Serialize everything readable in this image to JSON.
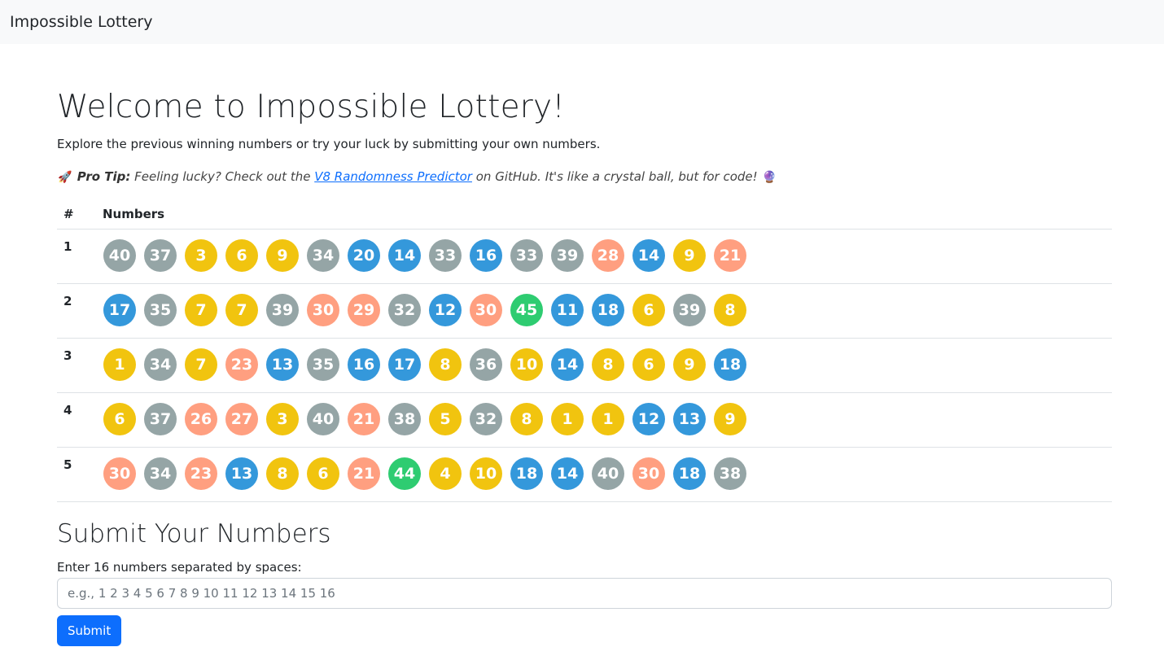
{
  "navbar": {
    "brand": "Impossible Lottery"
  },
  "main": {
    "title": "Welcome to Impossible Lottery!",
    "intro": "Explore the previous winning numbers or try your luck by submitting your own numbers.",
    "tip": {
      "emoji": "🚀",
      "label": "Pro Tip:",
      "text_before": "Feeling lucky? Check out the",
      "link": "V8 Randomness Predictor",
      "text_after": "on GitHub. It's like a crystal ball, but for code!",
      "emoji_end": "🔮"
    }
  },
  "table": {
    "headers": {
      "index": "#",
      "numbers": "Numbers"
    },
    "rows": [
      {
        "index": "1",
        "numbers": [
          40,
          37,
          3,
          6,
          9,
          34,
          20,
          14,
          33,
          16,
          33,
          39,
          28,
          14,
          9,
          21
        ]
      },
      {
        "index": "2",
        "numbers": [
          17,
          35,
          7,
          7,
          39,
          30,
          29,
          32,
          12,
          30,
          45,
          11,
          18,
          6,
          39,
          8
        ]
      },
      {
        "index": "3",
        "numbers": [
          1,
          34,
          7,
          23,
          13,
          35,
          16,
          17,
          8,
          36,
          10,
          14,
          8,
          6,
          9,
          18
        ]
      },
      {
        "index": "4",
        "numbers": [
          6,
          37,
          26,
          27,
          3,
          40,
          21,
          38,
          5,
          32,
          8,
          1,
          1,
          12,
          13,
          9
        ]
      },
      {
        "index": "5",
        "numbers": [
          30,
          34,
          23,
          13,
          8,
          6,
          21,
          44,
          4,
          10,
          18,
          14,
          40,
          30,
          18,
          38
        ]
      }
    ],
    "ball_colors": {
      "1-10": "#f1c40f",
      "11-20": "#3498db",
      "21-30": "#ff9f80",
      "31-40": "#95a5a6",
      "41-45": "#2ecc71"
    }
  },
  "form": {
    "title": "Submit Your Numbers",
    "label": "Enter 16 numbers separated by spaces:",
    "placeholder": "e.g., 1 2 3 4 5 6 7 8 9 10 11 12 13 14 15 16",
    "value": "",
    "submit_label": "Submit"
  }
}
